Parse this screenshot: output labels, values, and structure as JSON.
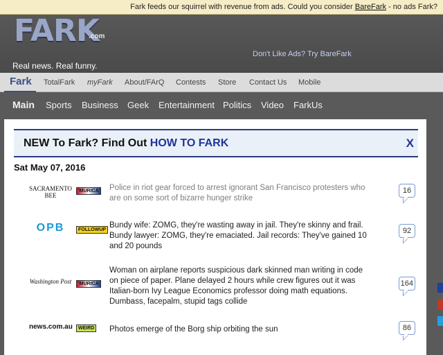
{
  "top_notice": {
    "text": "Fark feeds our squirrel with revenue from ads. Could you consider ",
    "link": "BareFark",
    "tail": " - no ads Fark?"
  },
  "header": {
    "logo": "FARK",
    "logo_suffix": ".com",
    "tagline": "Real news. Real funny.",
    "dont_like_ads": "Don't Like Ads? Try BareFark"
  },
  "tabs": [
    "Fark",
    "TotalFark",
    "myFark",
    "About/FArQ",
    "Contests",
    "Store",
    "Contact Us",
    "Mobile"
  ],
  "categories": [
    "Main",
    "Sports",
    "Business",
    "Geek",
    "Entertainment",
    "Politics",
    "Video",
    "FarkUs"
  ],
  "banner": {
    "text": "NEW To Fark? Find Out ",
    "link": "HOW TO FARK",
    "close": "X"
  },
  "date": "Sat May 07, 2016",
  "stories": [
    {
      "source": "SACRAMENTO BEE",
      "tag": "'MURICA",
      "headline": "Police in riot gear forced to arrest ignorant San Francisco protesters who are on some sort of bizarre hunger strike",
      "comments": "16"
    },
    {
      "source": "OPB",
      "tag": "FOLLOWUP",
      "headline": "Bundy wife: ZOMG, they're wasting away in jail. They're skinny and frail. Bundy lawyer: ZOMG, they're emaciated. Jail records: They've gained 10 and 20 pounds",
      "comments": "92"
    },
    {
      "source": "Washington Post",
      "tag": "'MURICA",
      "headline": "Woman on airplane reports suspicious dark skinned man writing in code on piece of paper. Plane delayed 2 hours while crew figures out it was Italian-born Ivy League Economics professor doing math equations. Dumbass, facepalm, stupid tags collide",
      "comments": "164"
    },
    {
      "source": "news.com.au",
      "tag": "WEIRD",
      "headline": "Photos emerge of the Borg ship orbiting the sun",
      "comments": "86"
    }
  ],
  "colors": {
    "accent": "#1e3597",
    "header_bg": "#5a5a5a",
    "notice_bg": "#f6ecc6"
  }
}
